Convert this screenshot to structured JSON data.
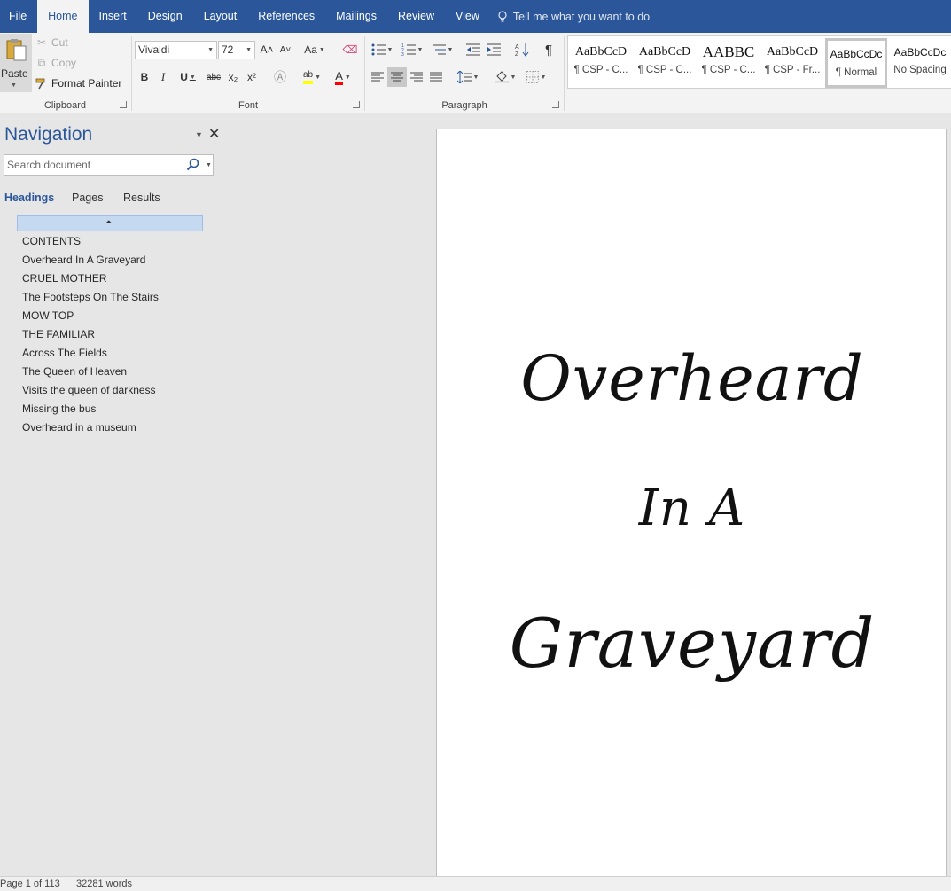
{
  "tabs": [
    {
      "label": "File",
      "active": false
    },
    {
      "label": "Home",
      "active": true
    },
    {
      "label": "Insert",
      "active": false
    },
    {
      "label": "Design",
      "active": false
    },
    {
      "label": "Layout",
      "active": false
    },
    {
      "label": "References",
      "active": false
    },
    {
      "label": "Mailings",
      "active": false
    },
    {
      "label": "Review",
      "active": false
    },
    {
      "label": "View",
      "active": false
    }
  ],
  "tell_me": "Tell me what you want to do",
  "clipboard": {
    "paste_label": "Paste",
    "cut_label": "Cut",
    "copy_label": "Copy",
    "format_painter_label": "Format Painter",
    "group_label": "Clipboard"
  },
  "font": {
    "name": "Vivaldi",
    "size": "72",
    "change_case_label": "Aa",
    "group_label": "Font",
    "bold": "B",
    "italic": "I",
    "underline": "U",
    "strikethrough": "abc",
    "subscript": "x₂",
    "superscript": "x²",
    "grow": "A˄",
    "shrink": "A˅",
    "font_color": "A",
    "highlight_color": "#ffff00",
    "text_color": "#ff0000"
  },
  "paragraph": {
    "group_label": "Paragraph",
    "pilcrow": "¶"
  },
  "styles": [
    {
      "preview": "AaBbCcD",
      "name": "¶ CSP - C...",
      "selected": false
    },
    {
      "preview": "AaBbCcD",
      "name": "¶ CSP - C...",
      "selected": false
    },
    {
      "preview": "AABBC",
      "name": "¶ CSP - C...",
      "selected": false
    },
    {
      "preview": "AaBbCcD",
      "name": "¶ CSP - Fr...",
      "selected": false
    },
    {
      "preview": "AaBbCcDc",
      "name": "¶ Normal",
      "selected": true
    },
    {
      "preview": "AaBbCcDc",
      "name": "No Spacing",
      "selected": false
    }
  ],
  "navigation": {
    "title": "Navigation",
    "search_placeholder": "Search document",
    "tabs": [
      {
        "label": "Headings",
        "active": true
      },
      {
        "label": "Pages",
        "active": false
      },
      {
        "label": "Results",
        "active": false
      }
    ],
    "headings": [
      "CONTENTS",
      "Overheard In A Graveyard",
      "CRUEL MOTHER",
      "The Footsteps On The Stairs",
      "MOW TOP",
      "THE FAMILIAR",
      "Across The Fields",
      "The Queen of Heaven",
      "Visits the queen of darkness",
      "Missing the bus",
      "Overheard in a museum"
    ]
  },
  "document": {
    "lines": [
      "Overheard",
      "In A",
      "Graveyard"
    ]
  },
  "status": {
    "page": "Page 1 of 113",
    "words": "32281 words"
  },
  "colors": {
    "accent": "#2b579a",
    "selection": "#c5d9f1"
  }
}
